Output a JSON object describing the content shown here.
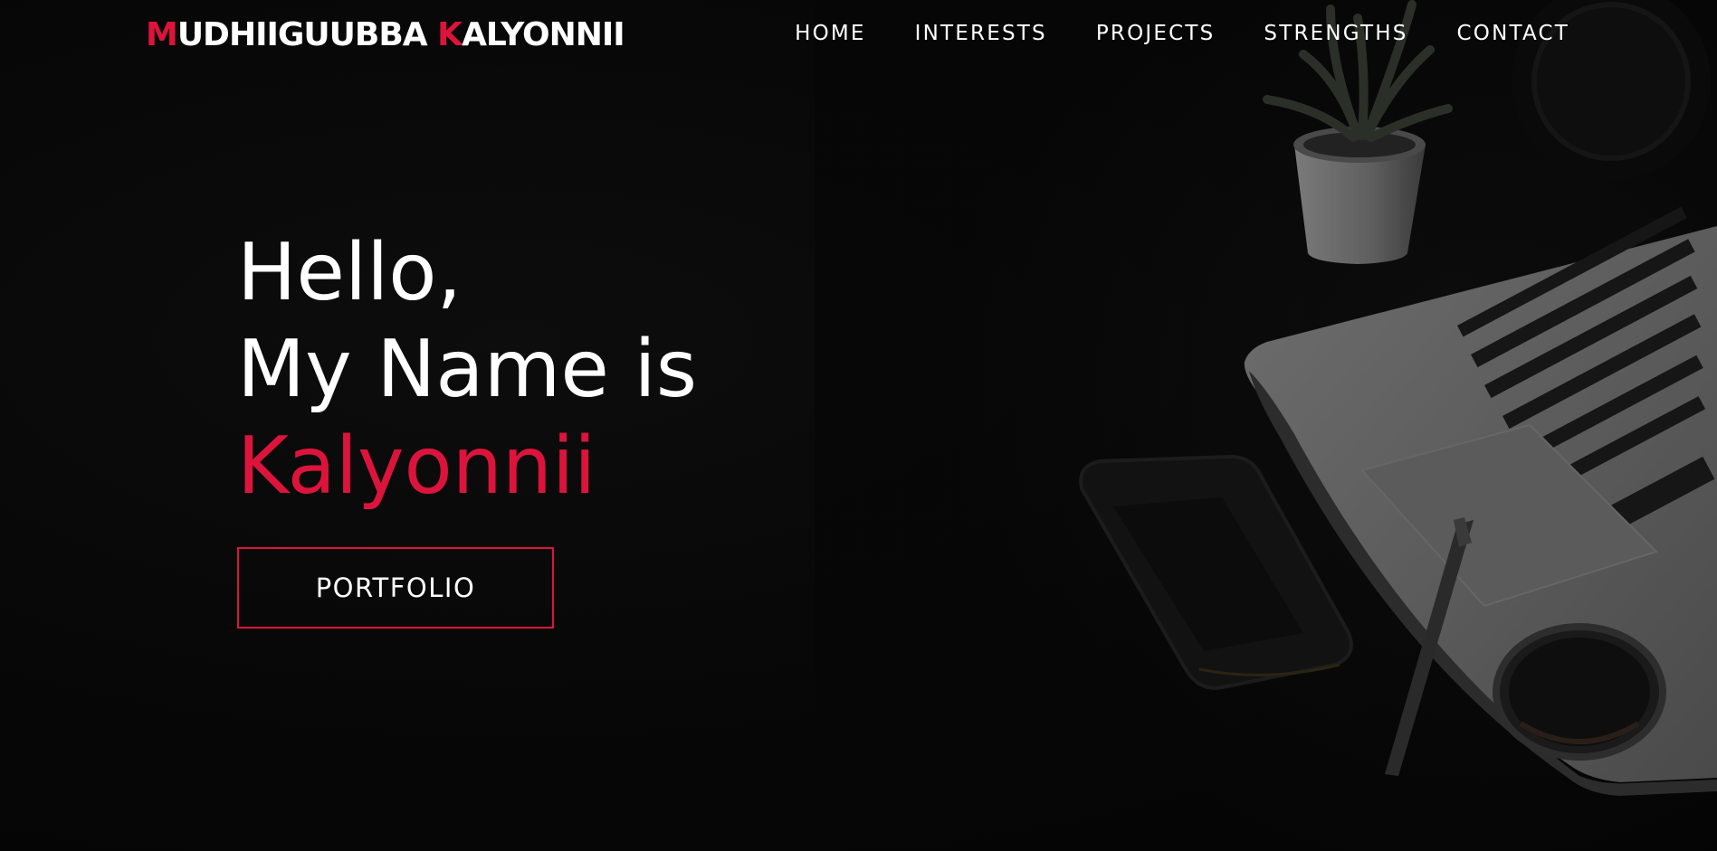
{
  "header": {
    "logo": {
      "first_initial": "M",
      "first_rest": "UDHIIGUUBBA ",
      "last_initial": "K",
      "last_rest": "ALYONNII"
    },
    "nav": [
      {
        "label": "HOME"
      },
      {
        "label": "INTERESTS"
      },
      {
        "label": "PROJECTS"
      },
      {
        "label": "STRENGTHS"
      },
      {
        "label": "CONTACT"
      }
    ]
  },
  "hero": {
    "line1": "Hello,",
    "line2": "My Name is",
    "name": "Kalyonnii",
    "button_label": "PORTFOLIO"
  },
  "colors": {
    "accent": "#dc143c",
    "background": "#070707",
    "text": "#ffffff"
  },
  "background_image": {
    "icons": [
      "plant-icon",
      "laptop-icon",
      "phone-icon",
      "pen-icon",
      "lens-icon"
    ]
  }
}
